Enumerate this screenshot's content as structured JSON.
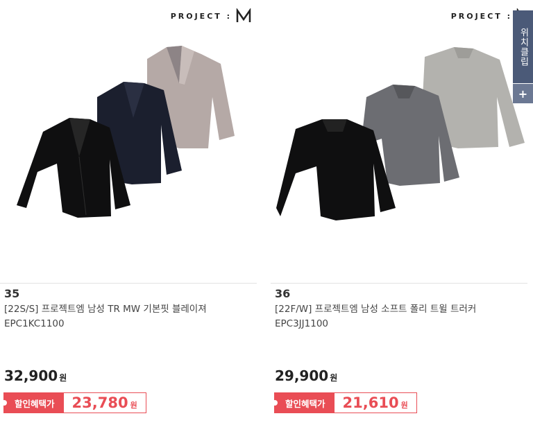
{
  "products": [
    {
      "brand": "PROJECT :",
      "number": "35",
      "name": "[22S/S] 프로젝트엠 남성 TR MW 기본핏 블레이져 EPC1KC1100",
      "price": "32,900",
      "currency": "원",
      "discount_label": "할인혜택가",
      "discount_price": "23,780"
    },
    {
      "brand": "PROJECT :",
      "number": "36",
      "name": "[22F/W] 프로젝트엠 남성 소프트 폴리 트윌 트러커 EPC3JJ1100",
      "price": "29,900",
      "currency": "원",
      "discount_label": "할인혜택가",
      "discount_price": "21,610"
    }
  ],
  "side_panel": {
    "label": "위치클립",
    "plus": "+"
  },
  "colors": {
    "accent_red": "#e94d55",
    "side_panel": "#4b5a78"
  }
}
